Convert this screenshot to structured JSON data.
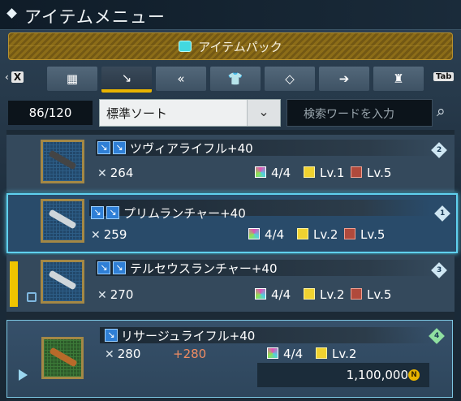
{
  "window": {
    "title": "アイテムメニュー"
  },
  "pack": {
    "label": "アイテムパック",
    "icon": "item-pack-icon"
  },
  "tabs": [
    {
      "icon": "grid-icon",
      "glyph": "▦"
    },
    {
      "icon": "sword-icon",
      "glyph": "↘",
      "active": true
    },
    {
      "icon": "double-chevron-left-icon",
      "glyph": "«"
    },
    {
      "icon": "shirt-icon",
      "glyph": "👕"
    },
    {
      "icon": "tag-icon",
      "glyph": "◇"
    },
    {
      "icon": "arrow-diamond-icon",
      "glyph": "➔"
    },
    {
      "icon": "bag-icon",
      "glyph": "♜"
    }
  ],
  "keys": {
    "left": "X",
    "right": "Tab"
  },
  "inventory": {
    "count": "86/120"
  },
  "sort": {
    "selected": "標準ソート"
  },
  "search": {
    "placeholder": "検索ワードを入力"
  },
  "items": [
    {
      "name": "ツヴィアライフル+40",
      "attack": "264",
      "slots": "4/4",
      "lv1": "Lv.1",
      "lv2": "Lv.5",
      "rank": "2"
    },
    {
      "name": "プリムランチャー+40",
      "attack": "259",
      "slots": "4/4",
      "lv1": "Lv.2",
      "lv2": "Lv.5",
      "rank": "1"
    },
    {
      "name": "テルセウスランチャー+40",
      "attack": "270",
      "slots": "4/4",
      "lv1": "Lv.2",
      "lv2": "Lv.5",
      "rank": "3"
    }
  ],
  "detail": {
    "name": "リサージュライフル+40",
    "attack": "280",
    "bonus": "+280",
    "slots": "4/4",
    "lv1": "Lv.2",
    "price": "1,100,000",
    "rank": "4"
  },
  "colors": {
    "accent": "#e8b400",
    "selected_border": "#5fd0ee"
  }
}
